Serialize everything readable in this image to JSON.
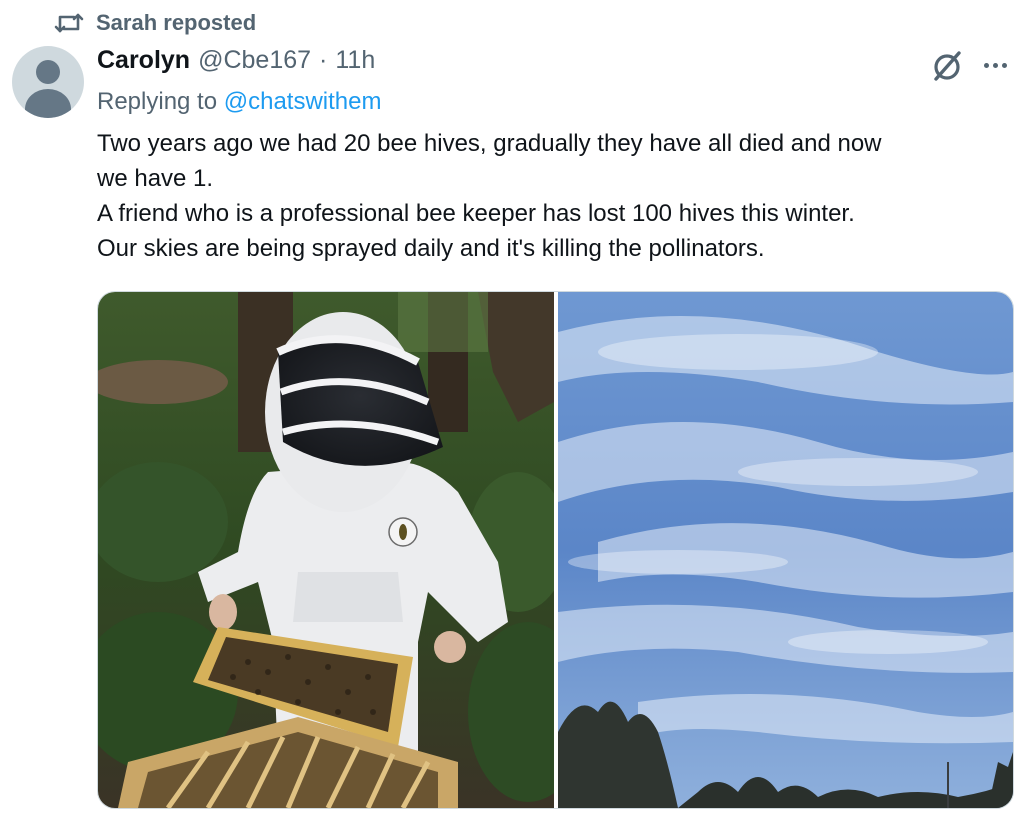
{
  "repost": {
    "label": "Sarah reposted",
    "icon": "repost-icon"
  },
  "tweet": {
    "author_name": "Carolyn",
    "author_handle": "@Cbe167",
    "separator": "·",
    "time": "11h",
    "replying_prefix": "Replying to",
    "replying_to": "@chatswithem",
    "text_lines": [
      "Two years ago we had 20 bee hives, gradually they have all died and now",
      "we have 1.",
      "A friend who is a professional bee keeper has lost 100 hives this winter.",
      "Our skies are being sprayed daily and it's killing the pollinators."
    ],
    "media": [
      {
        "name": "beekeeper-photo",
        "kind": "photo"
      },
      {
        "name": "sky-photo",
        "kind": "photo"
      }
    ]
  },
  "icons": {
    "grok": "grok-icon",
    "more": "more-options-icon",
    "avatar": "default-avatar-icon"
  },
  "colors": {
    "secondary_text": "#536471",
    "link": "#1d9bf0",
    "primary_text": "#0f1419"
  }
}
